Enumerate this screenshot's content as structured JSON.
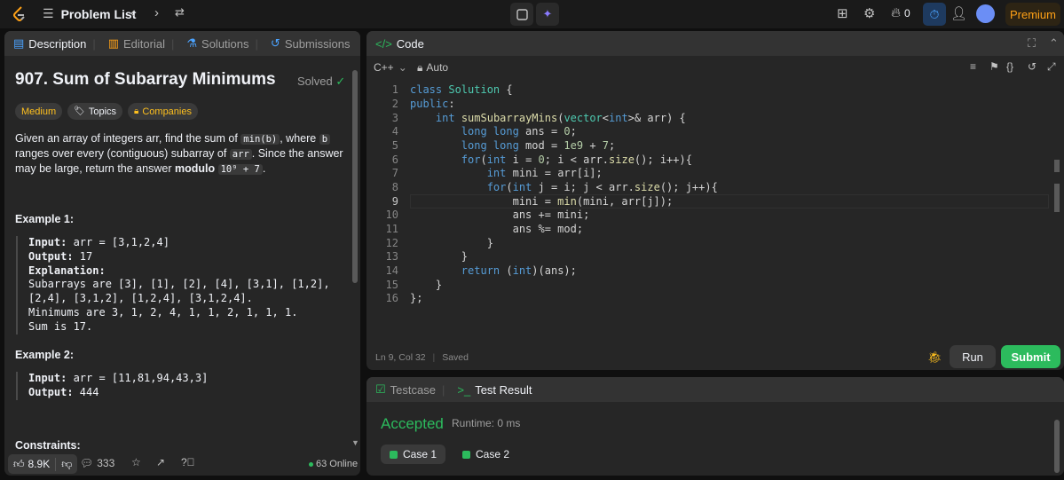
{
  "topbar": {
    "problem_list": "Problem List",
    "fire_count": "0",
    "premium": "Premium"
  },
  "left_panel": {
    "tabs": [
      {
        "label": "Description",
        "icon": "document-icon"
      },
      {
        "label": "Editorial",
        "icon": "book-icon"
      },
      {
        "label": "Solutions",
        "icon": "flask-icon"
      },
      {
        "label": "Submissions",
        "icon": "history-icon"
      }
    ],
    "title": "907. Sum of Subarray Minimums",
    "solved": "Solved",
    "tags": {
      "difficulty": "Medium",
      "topics": "Topics",
      "companies": "Companies"
    },
    "paragraph": {
      "p1": "Given an array of integers arr, find the sum of ",
      "c1": "min(b)",
      "p2": ", where ",
      "c2": "b",
      "p3": " ranges over every (contiguous) subarray of ",
      "c3": "arr",
      "p4": ". Since the answer may be large, return the answer ",
      "bold": "modulo",
      "c4": "10⁹ + 7",
      "p5": "."
    },
    "example1": {
      "title": "Example 1:",
      "input_label": "Input:",
      "input_value": " arr = [3,1,2,4]",
      "output_label": "Output:",
      "output_value": " 17",
      "explanation_label": "Explanation:",
      "line1": "Subarrays are [3], [1], [2], [4], [3,1], [1,2],",
      "line2": "[2,4], [3,1,2], [1,2,4], [3,1,2,4].",
      "line3": "Minimums are 3, 1, 2, 4, 1, 1, 2, 1, 1, 1.",
      "line4": "Sum is 17."
    },
    "example2": {
      "title": "Example 2:",
      "input_label": "Input:",
      "input_value": " arr = [11,81,94,43,3]",
      "output_label": "Output:",
      "output_value": " 444"
    },
    "constraints": "Constraints:",
    "footer": {
      "likes": "8.9K",
      "comments": "333",
      "online": "63 Online"
    }
  },
  "code_panel": {
    "tab": "Code",
    "language": "C++",
    "mode": "Auto",
    "lines": [
      "1",
      "2",
      "3",
      "4",
      "5",
      "6",
      "7",
      "8",
      "9",
      "10",
      "11",
      "12",
      "13",
      "14",
      "15",
      "16"
    ],
    "status": "Ln 9, Col 32",
    "saved": "Saved",
    "run": "Run",
    "submit": "Submit"
  },
  "result_panel": {
    "tabs": [
      {
        "label": "Testcase"
      },
      {
        "label": "Test Result"
      }
    ],
    "verdict": "Accepted",
    "runtime": "Runtime: 0 ms",
    "cases": [
      "Case 1",
      "Case 2"
    ]
  },
  "colors": {
    "accent_green": "#2cbb5d",
    "medium_yellow": "#ffc01e",
    "premium_orange": "#ffa116"
  }
}
